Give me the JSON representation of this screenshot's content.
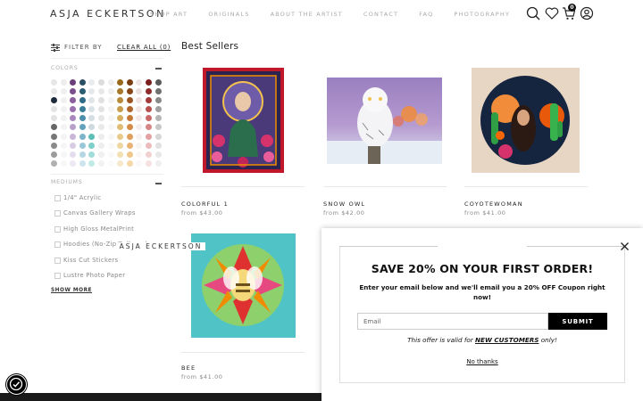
{
  "brand": "ASJA ECKERTSON",
  "nav": [
    "SHOP ART",
    "ORIGINALS",
    "ABOUT THE ARTIST",
    "CONTACT",
    "FAQ",
    "PHOTOGRAPHY"
  ],
  "cart_count": "0",
  "icons": [
    "search-icon",
    "heart-icon",
    "cart-icon",
    "account-icon"
  ],
  "sidebar": {
    "filter_label": "FILTER BY",
    "clear_all": "CLEAR ALL (0)",
    "colors_title": "COLORS",
    "mediums_title": "MEDIUMS",
    "mediums": [
      "1/4\" Acrylic",
      "Canvas Gallery Wraps",
      "High Gloss MetalPrint",
      "Hoodies (No-Zip/Pullover)",
      "Kiss Cut Stickers",
      "Lustre Photo Paper"
    ],
    "show_more": "SHOW MORE",
    "swatch_colors": [
      "#e6e6e6",
      "#ededed",
      "#6b3f7a",
      "#2a4e63",
      "#e9ecef",
      "#dcdcdc",
      "#eeeeee",
      "#9a6a1c",
      "#7a3c12",
      "#ede5e5",
      "#7a1e1e",
      "#5a5a5a",
      "#e8e8e8",
      "#efefef",
      "#7a4f8c",
      "#2b5c74",
      "#e5e9ec",
      "#e8e8e8",
      "#efefef",
      "#a6782b",
      "#87461a",
      "#eadede",
      "#8e2a2a",
      "#707070",
      "#1e2b3c",
      "#f0f0f0",
      "#8b5e9e",
      "#2f6b86",
      "#dfe6ea",
      "#e0e0e0",
      "#f2f2f2",
      "#b88b3a",
      "#9c5522",
      "#efe3e3",
      "#a33a3a",
      "#888888",
      "#e4e4e4",
      "#f1f1f1",
      "#9a6fae",
      "#3a7d99",
      "#d9e3e7",
      "#e3e3e3",
      "#f4f4f4",
      "#c89d4d",
      "#b0652c",
      "#f1e6e6",
      "#b85050",
      "#a0a0a0",
      "#e2e2e2",
      "#f2f2f2",
      "#a987bd",
      "#4d8eaa",
      "#d4dfe3",
      "#e6e6e6",
      "#f5f5f5",
      "#d6ae5f",
      "#c47838",
      "#f3eaea",
      "#c96a6a",
      "#b5b5b5",
      "#666666",
      "#f3f3f3",
      "#b9a0cb",
      "#63a2bc",
      "#cfdadf",
      "#e9e9e9",
      "#f6f6f6",
      "#e0bd74",
      "#d48b48",
      "#f5eeee",
      "#d78686",
      "#c8c8c8",
      "#777777",
      "#f4f4f4",
      "#c9b6d8",
      "#7fb5ca",
      "#5bbfb8",
      "#ececec",
      "#f7f7f7",
      "#e8ca8a",
      "#e0a05c",
      "#f7f1f1",
      "#e3a2a2",
      "#d6d6d6",
      "#8a8a8a",
      "#f5f5f5",
      "#d8cbe4",
      "#9ac7d8",
      "#7ecfc9",
      "#eeeeee",
      "#f8f8f8",
      "#eed6a0",
      "#e8b372",
      "#f8f4f4",
      "#ebbcbc",
      "#e0e0e0",
      "#9c9c9c",
      "#f6f6f6",
      "#e5dcee",
      "#b5d7e4",
      "#a1ddd8",
      "#f0f0f0",
      "#f9f9f9",
      "#f2e0b5",
      "#efc68c",
      "#faf6f6",
      "#f1d0d0",
      "#e8e8e8",
      "#b0b0b0",
      "#f7f7f7",
      "#eee8f4",
      "#cde4ee",
      "#c1eae6",
      "#f2f2f2",
      "#fafafa",
      "#f6e9cb",
      "#f4d8a8",
      "#fbf8f8",
      "#f6e0e0",
      "#efefef"
    ]
  },
  "main": {
    "title": "Best Sellers",
    "products": [
      {
        "name": "COLORFUL 1",
        "price": "from $43.00"
      },
      {
        "name": "SNOW OWL",
        "price": "from $42.00"
      },
      {
        "name": "COYOTEWOMAN",
        "price": "from $41.00"
      },
      {
        "name": "BEE",
        "price": "from $41.00"
      }
    ]
  },
  "popup": {
    "brand": "ASJA ECKERTSON",
    "headline": "SAVE 20% ON YOUR FIRST ORDER!",
    "description": "Enter your email below and we'll email you a 20% OFF Coupon right now!",
    "email_placeholder": "Email",
    "submit_label": "SUBMIT",
    "offer_prefix": "This offer is valid for ",
    "offer_emphasis": "NEW CUSTOMERS",
    "offer_suffix": " only!",
    "no_thanks": "No thanks"
  },
  "colors": {
    "accent": "#000000",
    "muted_text": "#aaaaaa"
  }
}
